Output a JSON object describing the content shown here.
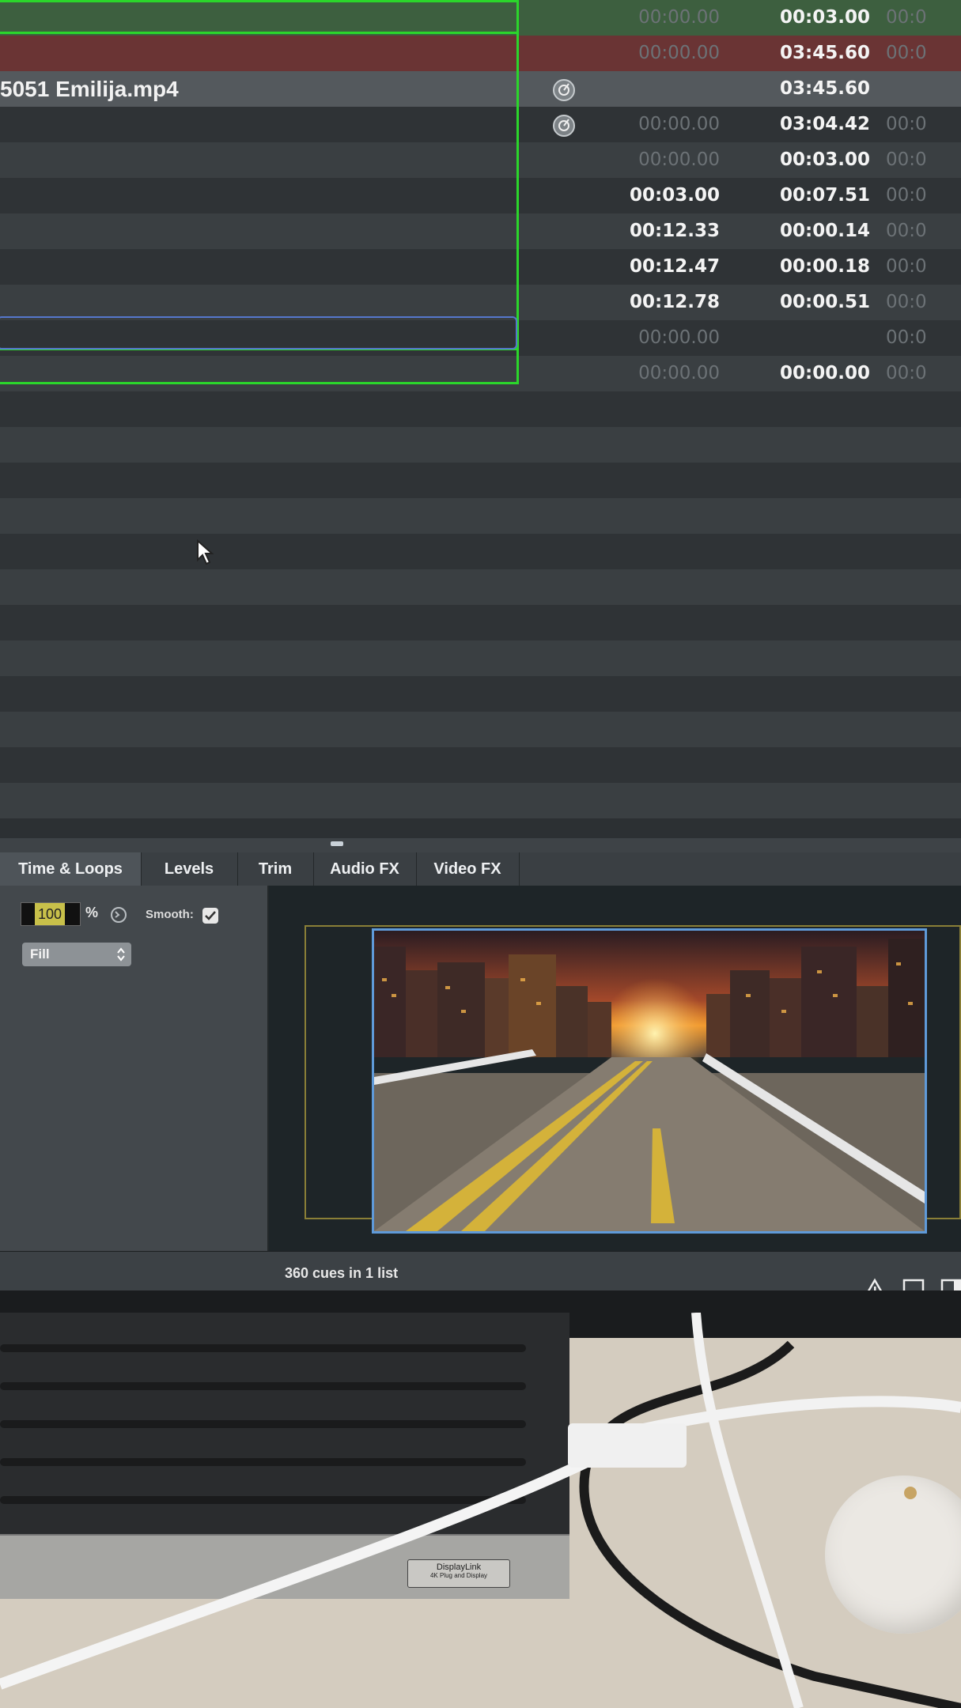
{
  "cue_list": {
    "rows": [
      {
        "name": "",
        "pre_wait": "00:00.00",
        "pre_wait_style": "dim",
        "action": "00:03.00",
        "post": "00:0",
        "icon": false
      },
      {
        "name": "",
        "pre_wait": "00:00.00",
        "pre_wait_style": "dim",
        "action": "03:45.60",
        "post": "00:0",
        "icon": false
      },
      {
        "name": "5051 Emilija.mp4",
        "pre_wait": "",
        "pre_wait_style": "dim",
        "action": "03:45.60",
        "post": "",
        "icon": true
      },
      {
        "name": "",
        "pre_wait": "00:00.00",
        "pre_wait_style": "dim",
        "action": "03:04.42",
        "post": "00:0",
        "icon": true
      },
      {
        "name": "",
        "pre_wait": "00:00.00",
        "pre_wait_style": "dim",
        "action": "00:03.00",
        "post": "00:0",
        "icon": false
      },
      {
        "name": "",
        "pre_wait": "00:03.00",
        "pre_wait_style": "bright",
        "action": "00:07.51",
        "post": "00:0",
        "icon": false
      },
      {
        "name": "",
        "pre_wait": "00:12.33",
        "pre_wait_style": "bright",
        "action": "00:00.14",
        "post": "00:0",
        "icon": false
      },
      {
        "name": "",
        "pre_wait": "00:12.47",
        "pre_wait_style": "bright",
        "action": "00:00.18",
        "post": "00:0",
        "icon": false
      },
      {
        "name": "",
        "pre_wait": "00:12.78",
        "pre_wait_style": "bright",
        "action": "00:00.51",
        "post": "00:0",
        "icon": false
      },
      {
        "name": "",
        "pre_wait": "00:00.00",
        "pre_wait_style": "dim",
        "action": "",
        "post": "00:0",
        "icon": false
      },
      {
        "name": "",
        "pre_wait": "00:00.00",
        "pre_wait_style": "dim",
        "action": "00:00.00",
        "post": "00:0",
        "icon": false
      }
    ]
  },
  "inspector": {
    "tabs": [
      "Time & Loops",
      "Levels",
      "Trim",
      "Audio FX",
      "Video FX"
    ],
    "scale_value": "100",
    "scale_unit": "%",
    "smooth_label": "Smooth:",
    "smooth_checked": true,
    "fill_mode": "Fill"
  },
  "status_bar": {
    "cue_count_text": "360 cues in 1 list"
  },
  "hardware": {
    "dock_badge_line1": "DisplayLink",
    "dock_badge_line2": "4K Plug and Display"
  },
  "colors": {
    "selection_green": "#2bd62b",
    "selection_blue": "#5577cc",
    "preview_border": "#5f9ad9"
  }
}
